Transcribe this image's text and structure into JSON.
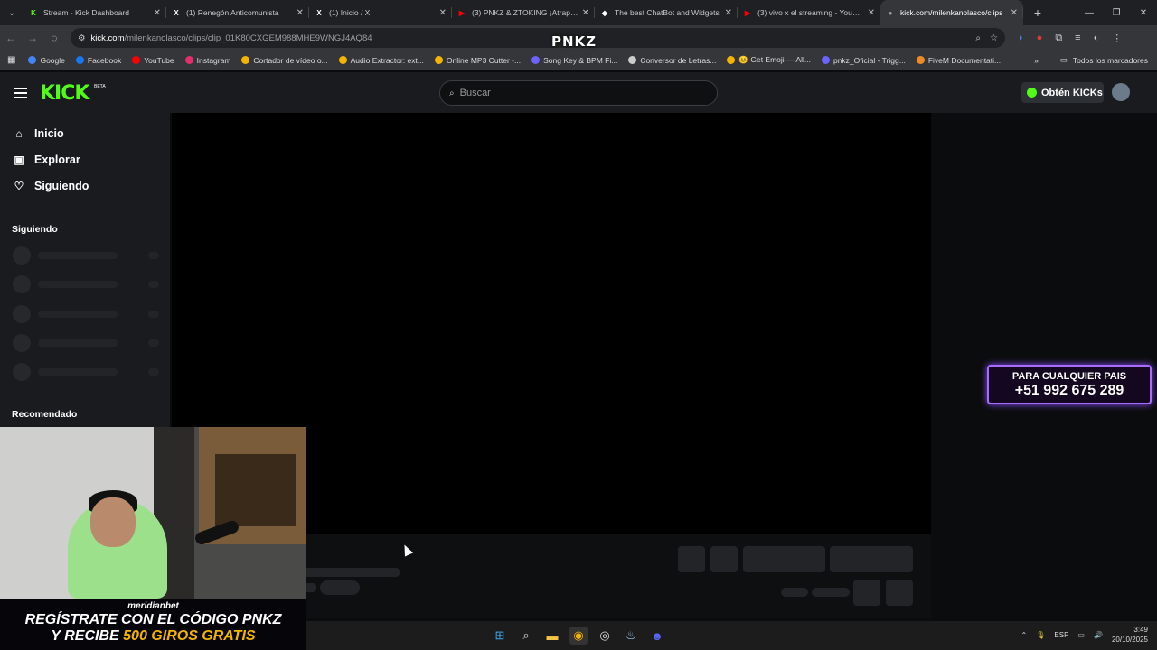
{
  "browser": {
    "tabs": [
      {
        "title": "Stream - Kick Dashboard",
        "fav": "K",
        "fav_color": "#53fc18"
      },
      {
        "title": "(1) Renegón Anticomunista",
        "fav": "X",
        "fav_color": "#ffffff"
      },
      {
        "title": "(1) Inicio / X",
        "fav": "X",
        "fav_color": "#ffffff"
      },
      {
        "title": "(3) PNKZ & ZTOKING ¡Atrapad",
        "fav": "▶",
        "fav_color": "#ff0000"
      },
      {
        "title": "The best ChatBot and Widgets",
        "fav": "◆",
        "fav_color": "#ffffff"
      },
      {
        "title": "(3) vivo x el streaming - YouTub",
        "fav": "▶",
        "fav_color": "#ff0000"
      },
      {
        "title": "kick.com/milenkanolasco/clips",
        "fav": "●",
        "fav_color": "#9aa0a6"
      }
    ],
    "url_domain": "kick.com",
    "url_path": "/milenkanolasco/clips/clip_01K80CXGEM988MHE9WNGJ4AQ84",
    "overlay_logo": "PNKZ",
    "bookmarks": [
      {
        "label": "Google",
        "color": "#4285f4"
      },
      {
        "label": "Facebook",
        "color": "#1877f2"
      },
      {
        "label": "YouTube",
        "color": "#ff0000"
      },
      {
        "label": "Instagram",
        "color": "#e1306c"
      },
      {
        "label": "Cortador de vídeo o...",
        "color": "#f4b400"
      },
      {
        "label": "Audio Extractor: ext...",
        "color": "#f4b400"
      },
      {
        "label": "Online MP3 Cutter -...",
        "color": "#f4b400"
      },
      {
        "label": "Song Key & BPM Fi...",
        "color": "#6c63ff"
      },
      {
        "label": "Conversor de Letras...",
        "color": "#cccccc"
      },
      {
        "label": "😊 Get Emoji — All...",
        "color": "#f4b400"
      },
      {
        "label": "pnkz_Oficial - Trigg...",
        "color": "#6c63ff"
      },
      {
        "label": "FiveM Documentati...",
        "color": "#f08a24"
      }
    ],
    "bookmarks_all": "Todos los marcadores"
  },
  "kick": {
    "logo": "KICK",
    "beta": "BETA",
    "search_placeholder": "Buscar",
    "get_kicks": "Obtén KICKs",
    "nav": [
      {
        "label": "Inicio",
        "icon": "home-icon"
      },
      {
        "label": "Explorar",
        "icon": "explore-icon"
      },
      {
        "label": "Siguiendo",
        "icon": "heart-icon"
      }
    ],
    "following_heading": "Siguiendo",
    "recommended_heading": "Recomendado"
  },
  "overlays": {
    "promo_line1": "PARA CUALQUIER PAIS",
    "promo_line2": "+51 992 675 289",
    "banner_brand": "meridianbet",
    "banner_line1": "REGÍSTRATE CON EL CÓDIGO PNKZ",
    "banner_line2_prefix": "Y RECIBE",
    "banner_line2_highlight": "500 GIROS GRATIS"
  },
  "taskbar": {
    "lang": "ESP",
    "time": "3:49",
    "date": "20/10/2025"
  },
  "colors": {
    "kick_green": "#53fc18",
    "promo_border": "#a86bff"
  }
}
